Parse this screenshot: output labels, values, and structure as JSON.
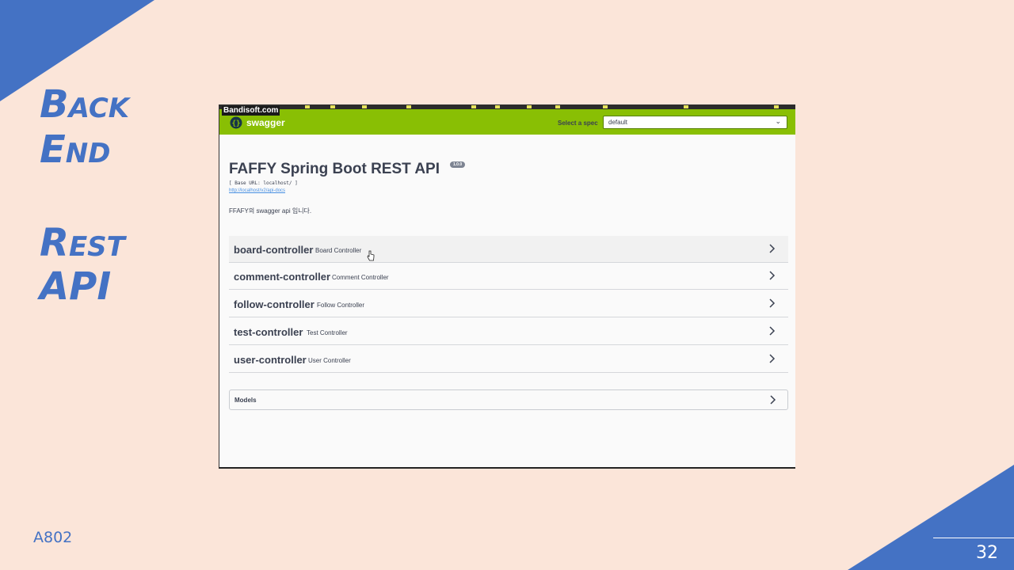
{
  "slide": {
    "title_line1": "Back",
    "title_line2": "End",
    "title_line3": "Rest",
    "title_line4": "API",
    "footer": "A802",
    "page_number": "32",
    "accent_color": "#4472c4",
    "background_color": "#fbe5d9"
  },
  "recorder": {
    "watermark": "Bandisoft.com"
  },
  "swagger": {
    "brand": "swagger",
    "brand_color": "#89bf04",
    "spec_label": "Select a spec",
    "spec_value": "default",
    "api_title": "FAFFY Spring Boot REST API",
    "version": "1.0.0",
    "base_url": "[ Base URL: localhost/ ]",
    "docs_link": "http://localhost/v2/api-docs",
    "description": "FFAFY의 swagger api 입니다.",
    "controllers": [
      {
        "name": "board-controller",
        "description": "Board Controller"
      },
      {
        "name": "comment-controller",
        "description": "Comment Controller"
      },
      {
        "name": "follow-controller",
        "description": "Follow Controller"
      },
      {
        "name": "test-controller",
        "description": "Test Controller"
      },
      {
        "name": "user-controller",
        "description": "User Controller"
      }
    ],
    "models_label": "Models"
  }
}
